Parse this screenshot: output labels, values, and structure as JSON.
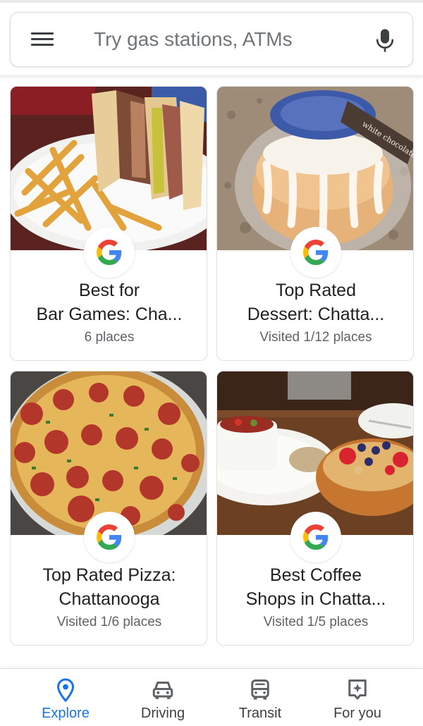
{
  "search": {
    "placeholder": "Try gas stations, ATMs",
    "menu_icon": "hamburger-menu-icon",
    "mic_icon": "microphone-icon"
  },
  "cards": [
    {
      "title": "Best for\nBar Games: Cha...",
      "subtitle": "6 places",
      "image": "sandwich-and-fries-photo",
      "badge_icon": "google-g-icon"
    },
    {
      "title": "Top Rated\nDessert: Chatta...",
      "subtitle": "Visited 1/12 places",
      "image": "bundt-cake-photo",
      "badge_icon": "google-g-icon"
    },
    {
      "title": "Top Rated Pizza:\nChattanooga",
      "subtitle": "Visited 1/6 places",
      "image": "pepperoni-pizza-photo",
      "badge_icon": "google-g-icon"
    },
    {
      "title": "Best Coffee\nShops in Chatta...",
      "subtitle": "Visited 1/5 places",
      "image": "coffee-and-fruit-bowl-photo",
      "badge_icon": "google-g-icon"
    }
  ],
  "nav": {
    "items": [
      {
        "label": "Explore",
        "icon": "location-pin-icon",
        "active": true
      },
      {
        "label": "Driving",
        "icon": "car-icon",
        "active": false
      },
      {
        "label": "Transit",
        "icon": "bus-icon",
        "active": false
      },
      {
        "label": "For you",
        "icon": "sparkle-badge-icon",
        "active": false
      }
    ]
  },
  "colors": {
    "accent": "#1a73e8",
    "google_blue": "#4285F4",
    "google_red": "#EA4335",
    "google_yellow": "#FBBC05",
    "google_green": "#34A853",
    "icon_gray": "#5f6368"
  }
}
